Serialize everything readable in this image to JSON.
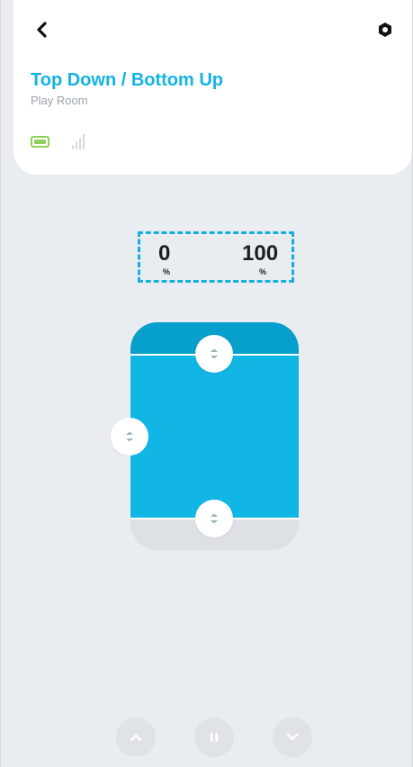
{
  "header": {
    "title": "Top Down / Bottom Up",
    "room": "Play Room",
    "back_icon": "chevron-left-icon",
    "settings_icon": "hexagon-settings-icon",
    "battery_icon": "battery-full-icon",
    "signal_icon": "signal-bars-icon"
  },
  "readout": {
    "top_value": "0",
    "top_unit": "%",
    "bottom_value": "100",
    "bottom_unit": "%"
  },
  "shade": {
    "top_position_percent": 0,
    "bottom_position_percent": 100,
    "colors": {
      "rail": "#079fcb",
      "fabric": "#12b6e4",
      "track": "#dde1e5"
    }
  },
  "controls": {
    "open_icon": "chevron-up-icon",
    "stop_icon": "pause-icon",
    "close_icon": "chevron-down-icon"
  },
  "colors": {
    "accent": "#13b3e6",
    "background": "#e9edf1",
    "battery": "#8fd05a"
  }
}
